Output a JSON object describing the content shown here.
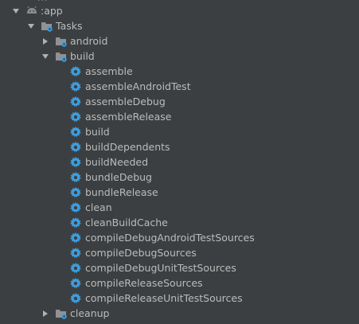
{
  "tree": {
    "top_fragment": "••• ... • •• •••",
    "app": {
      "label": ":app",
      "icon": "android-robot-icon",
      "expanded": true
    },
    "tasks": {
      "label": "Tasks",
      "icon": "folder-gear-icon",
      "expanded": true
    },
    "groups": [
      {
        "label": "android",
        "expanded": false
      },
      {
        "label": "build",
        "expanded": true
      },
      {
        "label": "cleanup",
        "expanded": false
      }
    ],
    "build_tasks": [
      "assemble",
      "assembleAndroidTest",
      "assembleDebug",
      "assembleRelease",
      "build",
      "buildDependents",
      "buildNeeded",
      "bundleDebug",
      "bundleRelease",
      "clean",
      "cleanBuildCache",
      "compileDebugAndroidTestSources",
      "compileDebugSources",
      "compileDebugUnitTestSources",
      "compileReleaseSources",
      "compileReleaseUnitTestSources"
    ]
  },
  "colors": {
    "background": "#3c3f41",
    "text": "#bbbbbb",
    "arrow": "#afb1b3",
    "folder": "#8e9297",
    "gear": "#3d9ee0",
    "android": "#8a8d8f"
  }
}
